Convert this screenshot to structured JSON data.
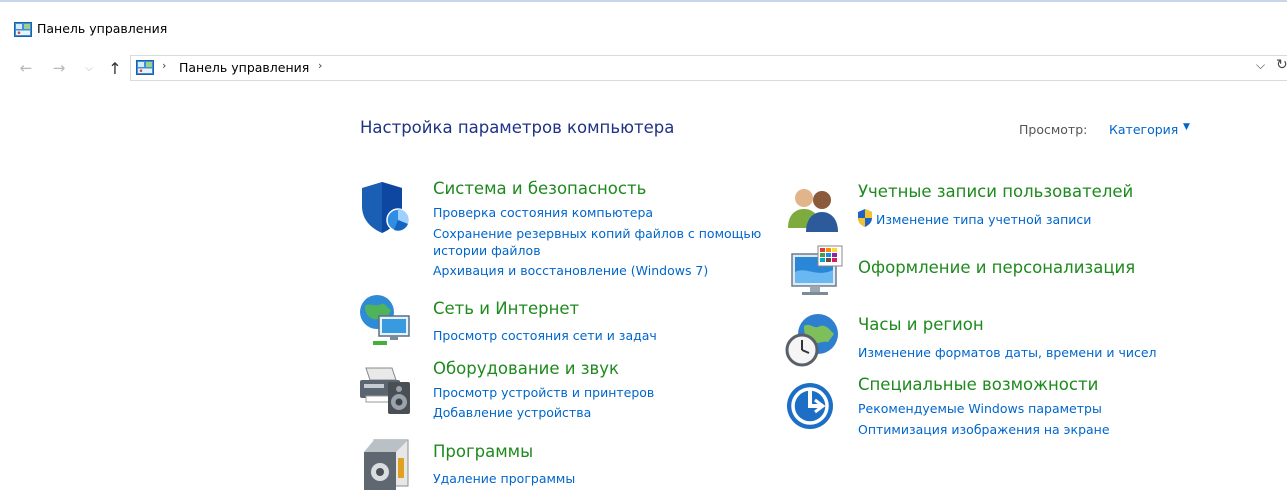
{
  "window": {
    "title": "Панель управления"
  },
  "address": {
    "crumb": "Панель управления",
    "separator": "›"
  },
  "nav": {
    "back": "←",
    "forward": "→",
    "recent": "⌵",
    "up": "↑",
    "dropdown": "⌵",
    "refresh": "↻"
  },
  "header": {
    "title": "Настройка параметров компьютера",
    "view_label": "Просмотр:",
    "view_value": "Категория",
    "view_arrow": "▼"
  },
  "categories": {
    "system": {
      "title": "Система и безопасность",
      "icon": "shield-icon",
      "links": [
        "Проверка состояния компьютера",
        "Сохранение резервных копий файлов с помощью",
        "истории файлов",
        "Архивация и восстановление (Windows 7)"
      ]
    },
    "network": {
      "title": "Сеть и Интернет",
      "icon": "network-globe-icon",
      "links": [
        "Просмотр состояния сети и задач"
      ]
    },
    "hardware": {
      "title": "Оборудование и звук",
      "icon": "printer-speaker-icon",
      "links": [
        "Просмотр устройств и принтеров",
        "Добавление устройства"
      ]
    },
    "programs": {
      "title": "Программы",
      "icon": "programs-box-icon",
      "links": [
        "Удаление программы"
      ]
    },
    "accounts": {
      "title": "Учетные записи пользователей",
      "icon": "users-icon",
      "links": [
        "Изменение типа учетной записи"
      ]
    },
    "appearance": {
      "title": "Оформление и персонализация",
      "icon": "monitor-palette-icon",
      "links": []
    },
    "clock": {
      "title": "Часы и регион",
      "icon": "clock-globe-icon",
      "links": [
        "Изменение форматов даты, времени и чисел"
      ]
    },
    "access": {
      "title": "Специальные возможности",
      "icon": "accessibility-icon",
      "links": [
        "Рекомендуемые Windows параметры",
        "Оптимизация изображения на экране"
      ]
    }
  },
  "colors": {
    "link": "#0066cc",
    "category_title": "#1e8a1e",
    "heading": "#1e3287"
  }
}
